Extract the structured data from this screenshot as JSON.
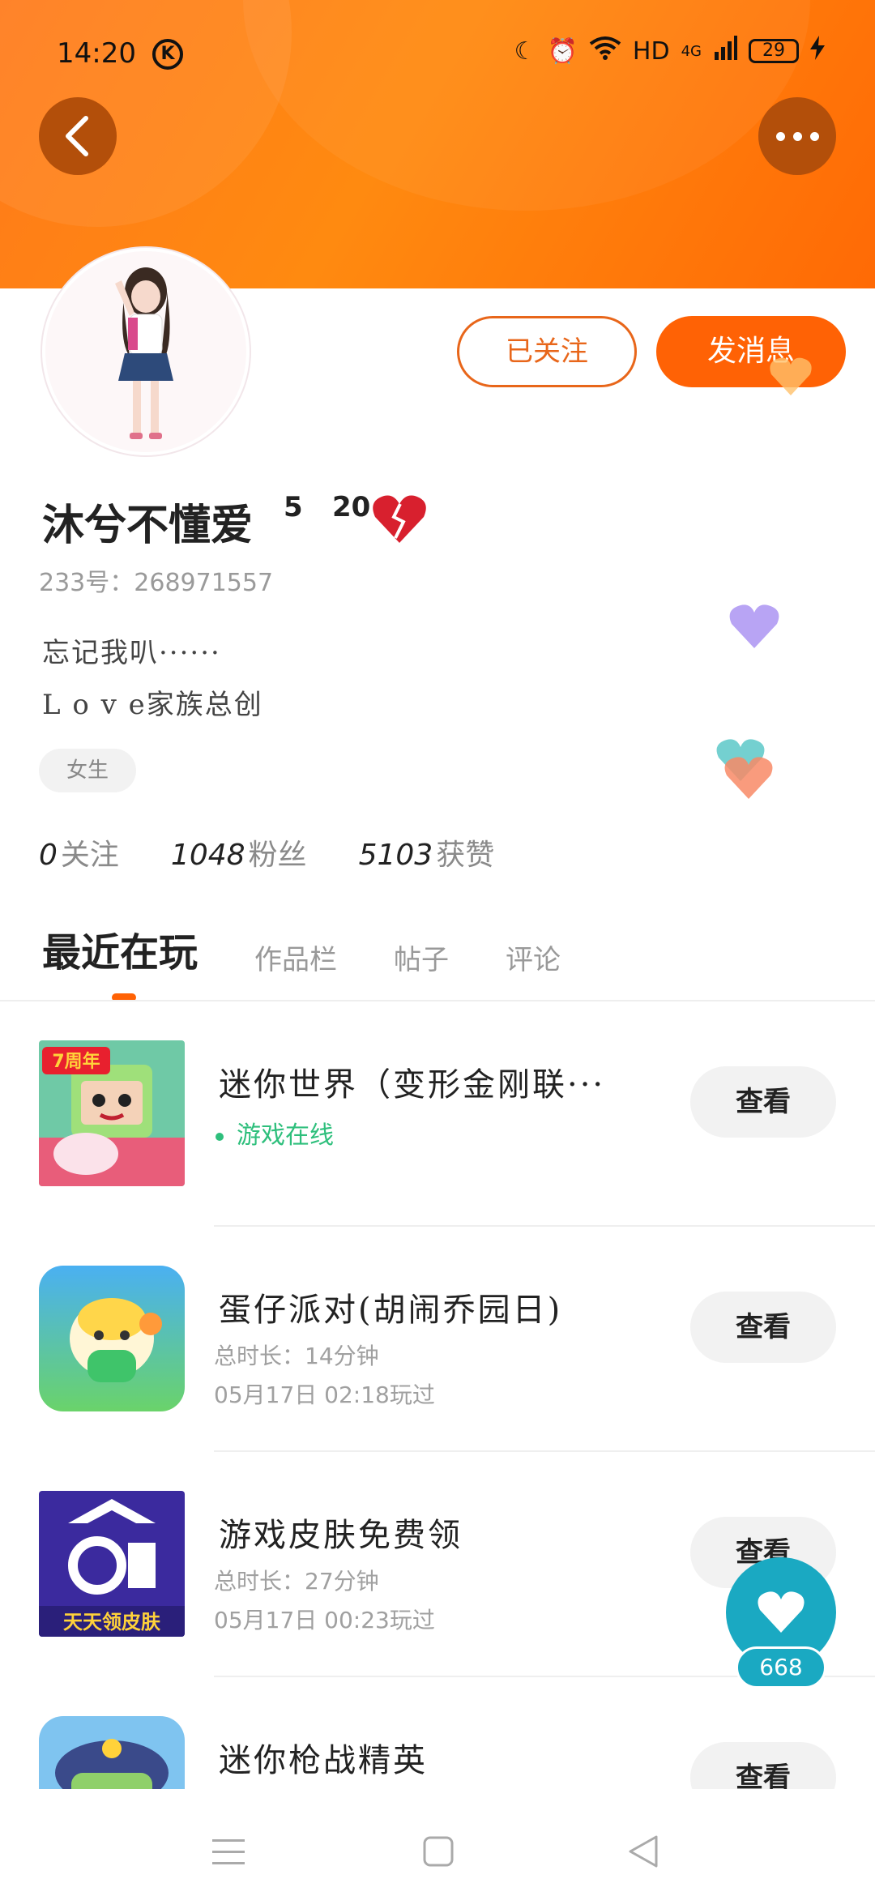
{
  "status_bar": {
    "time": "14:20",
    "carrier_icon": "K",
    "network": "HD",
    "network_type": "4G",
    "battery": "29"
  },
  "profile": {
    "nickname": "沐兮不懂爱",
    "nickname_sup_1": "5",
    "nickname_sup_2": "20",
    "id_label": "233号：",
    "id_value": "268971557",
    "bio_line1": "忘记我叭······",
    "bio_line2": "L o v e家族总创",
    "gender_tag": "女生",
    "follow_button": "已关注",
    "message_button": "发消息"
  },
  "stats": [
    {
      "value": "0",
      "label": "关注"
    },
    {
      "value": "1048",
      "label": "粉丝"
    },
    {
      "value": "5103",
      "label": "获赞"
    }
  ],
  "tabs": [
    {
      "label": "最近在玩",
      "active": true
    },
    {
      "label": "作品栏",
      "active": false
    },
    {
      "label": "帖子",
      "active": false
    },
    {
      "label": "评论",
      "active": false
    }
  ],
  "games": [
    {
      "title": "迷你世界（变形金刚联···",
      "status": "游戏在线",
      "duration": "",
      "last_played": "",
      "button": "查看",
      "icon_name": "mini-world-icon",
      "badge": "7周年"
    },
    {
      "title": "蛋仔派对(胡闹乔园日)",
      "status": "",
      "duration": "总时长：14分钟",
      "last_played": "05月17日 02:18玩过",
      "button": "查看",
      "icon_name": "eggy-party-icon"
    },
    {
      "title": "游戏皮肤免费领",
      "status": "",
      "duration": "总时长：27分钟",
      "last_played": "05月17日 00:23玩过",
      "button": "查看",
      "icon_name": "free-skin-icon",
      "icon_text": "天天领皮肤"
    },
    {
      "title": "迷你枪战精英",
      "status": "",
      "duration": "",
      "last_played": "",
      "button": "查看",
      "icon_name": "mini-gun-icon"
    }
  ],
  "like": {
    "count": "668"
  },
  "colors": {
    "brand_orange": "#ff6205",
    "header_gradient": "#ff7a1a",
    "online_green": "#2ebf7c",
    "like_teal": "#1aa9c2"
  }
}
